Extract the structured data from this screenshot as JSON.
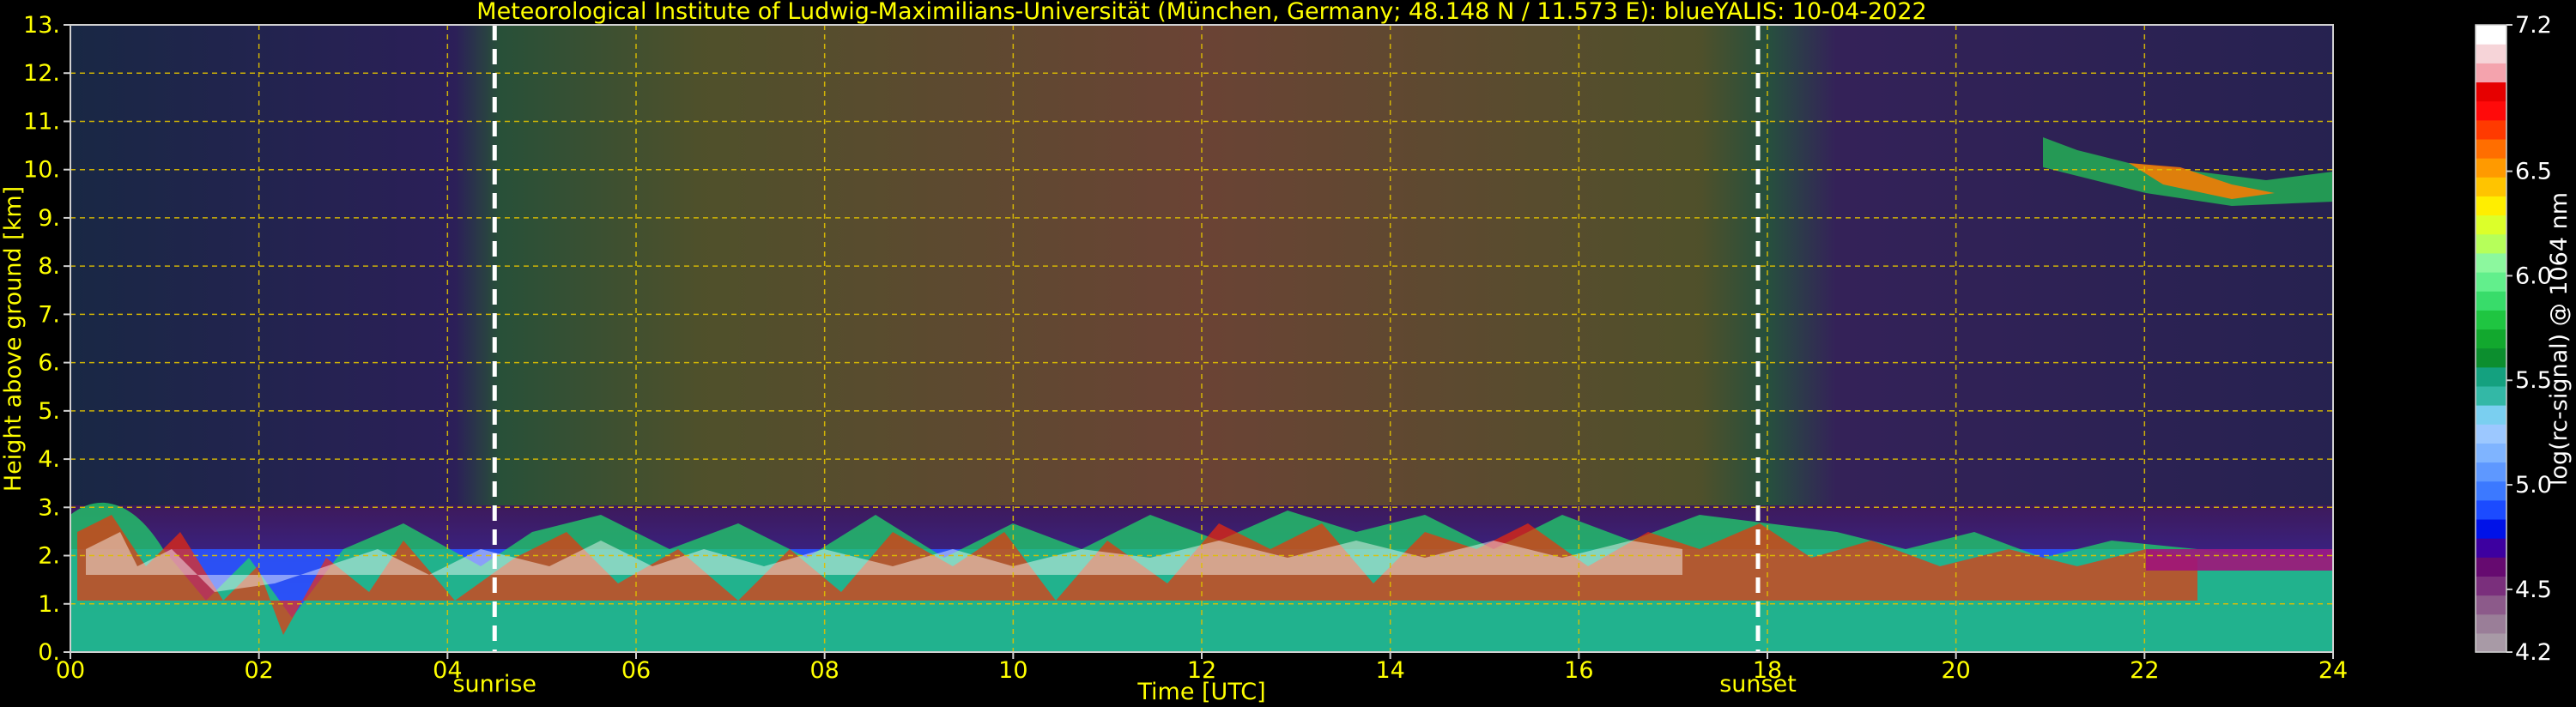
{
  "chart_data": {
    "type": "heatmap",
    "title": "Meteorological Institute of Ludwig-Maximilians-Universität (München, Germany; 48.148 N / 11.573 E):    blueYALIS: 10-04-2022",
    "xlabel": "Time [UTC]",
    "ylabel": "Height above ground [km]",
    "xlim": [
      0,
      24
    ],
    "ylim": [
      0,
      13
    ],
    "x_ticks": [
      "00",
      "02",
      "04",
      "06",
      "08",
      "10",
      "12",
      "14",
      "16",
      "18",
      "20",
      "22",
      "24"
    ],
    "y_ticks": [
      "0.",
      "1.",
      "2.",
      "3.",
      "4.",
      "5.",
      "6.",
      "7.",
      "8.",
      "9.",
      "10.",
      "11.",
      "12.",
      "13."
    ],
    "grid": true,
    "markers": [
      {
        "label": "sunrise",
        "x": 4.5
      },
      {
        "label": "sunset",
        "x": 17.9
      }
    ],
    "colorbar": {
      "label": "log(rc-signal) @ 1064 nm",
      "range": [
        4.2,
        7.2
      ],
      "ticks": [
        "7.2",
        "6.5",
        "6.0",
        "5.5",
        "5.0",
        "4.5",
        "4.2"
      ],
      "tick_values": [
        7.2,
        6.5,
        6.0,
        5.5,
        5.0,
        4.5,
        4.2
      ],
      "colors": [
        "#a89aa6",
        "#9a7e98",
        "#8c5a8a",
        "#7a2f7c",
        "#660a70",
        "#3d00a0",
        "#0012e8",
        "#1c4bff",
        "#3c79ff",
        "#5e98ff",
        "#7fb4ff",
        "#9cc8ff",
        "#7acff0",
        "#33b8a6",
        "#14a17f",
        "#0c8e2e",
        "#12a82e",
        "#1fc541",
        "#38dc6a",
        "#62ef8c",
        "#8cf89e",
        "#b6ff5a",
        "#dcff2a",
        "#ffee00",
        "#ffc400",
        "#ff9a00",
        "#ff6e00",
        "#ff3a00",
        "#ff0a0a",
        "#e60000",
        "#f4a3ad",
        "#f6d4d8",
        "#ffffff"
      ]
    }
  }
}
